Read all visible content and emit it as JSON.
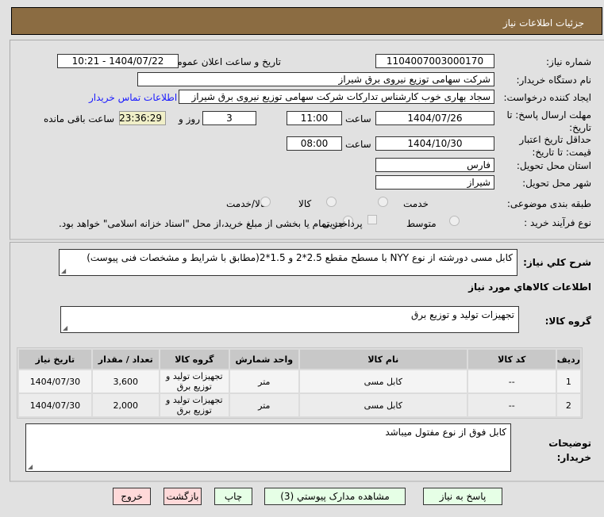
{
  "header": {
    "title": "جزئیات اطلاعات نیاز"
  },
  "form": {
    "need_number_label": "شماره نیاز:",
    "need_number": "1104007003000170",
    "announce_label": "تاریخ و ساعت اعلان عمومی:",
    "announce_value": "1404/07/22 - 10:21",
    "buyer_label": "نام دستگاه خریدار:",
    "buyer": "شرکت سهامی توزیع نیروی برق شیراز",
    "creator_label": "ایجاد کننده درخواست:",
    "creator": "سجاد بهاری خوب کارشناس تدارکات شرکت سهامی توزیع نیروی برق شیراز",
    "contact_link": "اطلاعات تماس خریدار",
    "deadline_label": "مهلت ارسال پاسخ: تا تاریخ:",
    "deadline_date": "1404/07/26",
    "time_label": "ساعت",
    "deadline_time": "11:00",
    "days": "3",
    "days_label": "روز و",
    "remaining": "23:36:29",
    "remaining_label": "ساعت باقی مانده",
    "validity_label": "حداقل تاریخ اعتبار قیمت: تا تاریخ:",
    "validity_date": "1404/10/30",
    "validity_time": "08:00",
    "province_label": "استان محل تحویل:",
    "province": "فارس",
    "city_label": "شهر محل تحویل:",
    "city": "شیراز",
    "category_label": "طبقه بندی موضوعی:",
    "category_options": [
      "کالا",
      "خدمت",
      "کالا/خدمت"
    ],
    "process_label": "نوع فرآیند خرید :",
    "process_options": [
      "جزیی",
      "متوسط"
    ],
    "payment_note": "پرداخت تمام یا بخشی از مبلغ خرید،از محل \"اسناد خزانه اسلامی\" خواهد بود."
  },
  "details": {
    "desc_label": "شرح كلي نياز:",
    "desc": "کابل مسی دورشته از نوع NYY با مسطح مقطع 2.5*2 و 1.5*2(مطابق با شرایط و مشخصات فنی پیوست)",
    "goods_title": "اطلاعات كالاهاي مورد نياز",
    "group_label": "گروه کالا:",
    "group": "تجهیزات تولید و توزیع برق",
    "table": {
      "headers": [
        "ردیف",
        "کد کالا",
        "نام کالا",
        "واحد شمارش",
        "گروه کالا",
        "تعداد / مقدار",
        "تاریخ نیاز"
      ],
      "rows": [
        [
          "1",
          "--",
          "کابل مسی",
          "متر",
          "تجهیزات تولید و توزیع برق",
          "3,600",
          "1404/07/30"
        ],
        [
          "2",
          "--",
          "کابل مسی",
          "متر",
          "تجهیزات تولید و توزیع برق",
          "2,000",
          "1404/07/30"
        ]
      ]
    },
    "notes_label": "توضیحات خریدار:",
    "notes": "کابل فوق از نوع مفتول میباشد"
  },
  "buttons": {
    "reply": "پاسخ به نیاز",
    "attachments": "مشاهده مدارک پیوستي (3)",
    "print": "چاپ",
    "back": "بازگشت",
    "exit": "خروج"
  }
}
